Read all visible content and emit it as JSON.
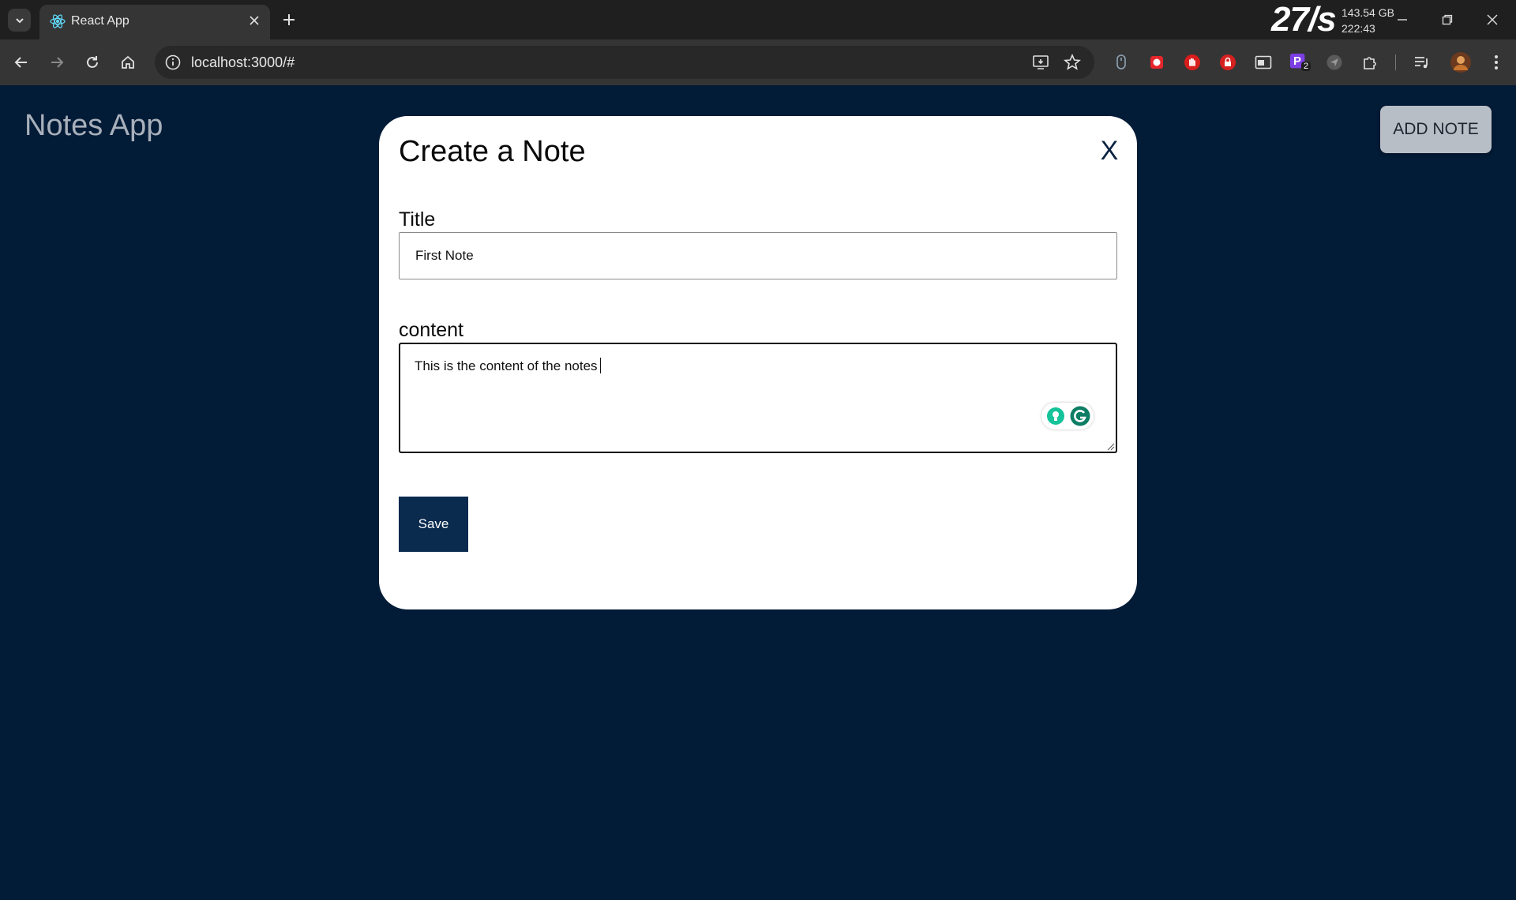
{
  "browser": {
    "tab_title": "React App",
    "url": "localhost:3000/#",
    "speed_overlay": "27/s",
    "disk_free": "143.54 GB",
    "clock": "222:43",
    "extension_badge": "2",
    "extension_letter": "P"
  },
  "app": {
    "title": "Notes App",
    "add_note_label": "ADD NOTE"
  },
  "modal": {
    "title": "Create a Note",
    "close_label": "X",
    "title_label": "Title",
    "title_value": "First Note",
    "content_label": "content",
    "content_value": "This is the content of the notes",
    "save_label": "Save"
  },
  "colors": {
    "page_background": "#021b36",
    "save_button": "#0a2a4e",
    "add_note_button": "#b8bec6",
    "grammarly_green": "#15c39a"
  }
}
